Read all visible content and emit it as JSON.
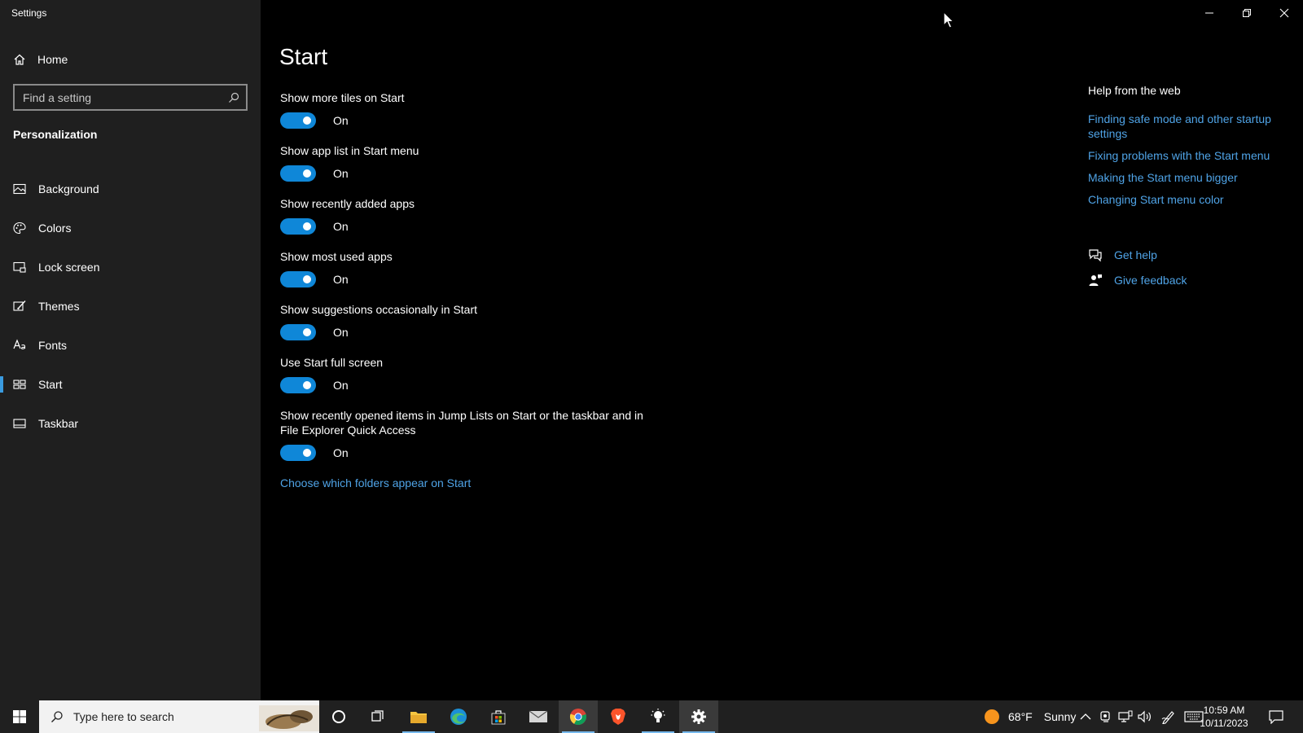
{
  "window": {
    "title": "Settings"
  },
  "sidebar": {
    "home_label": "Home",
    "search_placeholder": "Find a setting",
    "section_heading": "Personalization",
    "items": [
      {
        "label": "Background",
        "icon": "picture-icon"
      },
      {
        "label": "Colors",
        "icon": "palette-icon"
      },
      {
        "label": "Lock screen",
        "icon": "lock-screen-icon"
      },
      {
        "label": "Themes",
        "icon": "brush-icon"
      },
      {
        "label": "Fonts",
        "icon": "font-icon"
      },
      {
        "label": "Start",
        "icon": "start-layout-icon",
        "active": true
      },
      {
        "label": "Taskbar",
        "icon": "taskbar-icon"
      }
    ]
  },
  "main": {
    "page_title": "Start",
    "settings": [
      {
        "label": "Show more tiles on Start",
        "state": "On"
      },
      {
        "label": "Show app list in Start menu",
        "state": "On"
      },
      {
        "label": "Show recently added apps",
        "state": "On"
      },
      {
        "label": "Show most used apps",
        "state": "On"
      },
      {
        "label": "Show suggestions occasionally in Start",
        "state": "On"
      },
      {
        "label": "Use Start full screen",
        "state": "On"
      },
      {
        "label": "Show recently opened items in Jump Lists on Start or the taskbar and in File Explorer Quick Access",
        "state": "On"
      }
    ],
    "folders_link": "Choose which folders appear on Start"
  },
  "help": {
    "title": "Help from the web",
    "links": [
      "Finding safe mode and other startup settings",
      "Fixing problems with the Start menu",
      "Making the Start menu bigger",
      "Changing Start menu color"
    ],
    "get_help": "Get help",
    "give_feedback": "Give feedback"
  },
  "taskbar": {
    "search_placeholder": "Type here to search",
    "weather_temp": "68°F",
    "weather_text": "Sunny",
    "time": "10:59 AM",
    "date": "10/11/2023",
    "apps": [
      "cortana-icon",
      "task-view-icon",
      "file-explorer-icon",
      "edge-icon",
      "store-icon",
      "mail-icon",
      "chrome-icon",
      "brave-icon",
      "tips-icon",
      "settings-icon"
    ]
  },
  "colors": {
    "accent": "#0f87d8",
    "link": "#4fa3e6",
    "sidebar_bg": "#1f1f1f",
    "main_bg": "#000000",
    "taskbar_bg": "#202020"
  }
}
